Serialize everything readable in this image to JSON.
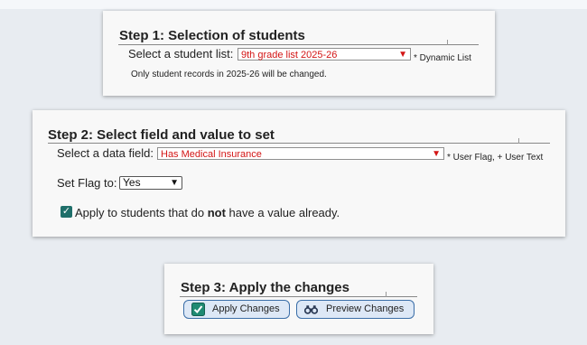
{
  "step1": {
    "title": "Step 1: Selection of students",
    "list_label": "Select a student list:",
    "list_value": "9th grade list 2025-26",
    "list_hint": "* Dynamic List",
    "note": "Only student records in 2025-26 will be changed."
  },
  "step2": {
    "title": "Step 2: Select field and value to set",
    "field_label": "Select a data field:",
    "field_value": "Has Medical Insurance",
    "field_hint": "* User Flag, + User Text",
    "flag_label": "Set Flag to:",
    "flag_value": "Yes",
    "apply_pre": "Apply to students that do ",
    "apply_bold": "not",
    "apply_post": " have a value already.",
    "apply_checked": true
  },
  "step3": {
    "title": "Step 3: Apply the changes",
    "apply_button": "Apply Changes",
    "preview_button": "Preview Changes"
  },
  "colors": {
    "select_text": "#d31515",
    "checkbox": "#1f6f6a",
    "button_border": "#3b6ea8",
    "button_bg": "#dde8f6"
  },
  "icons": {
    "apply": "checkmark-icon",
    "preview": "binoculars-icon",
    "dropdown": "chevron-down-icon"
  }
}
